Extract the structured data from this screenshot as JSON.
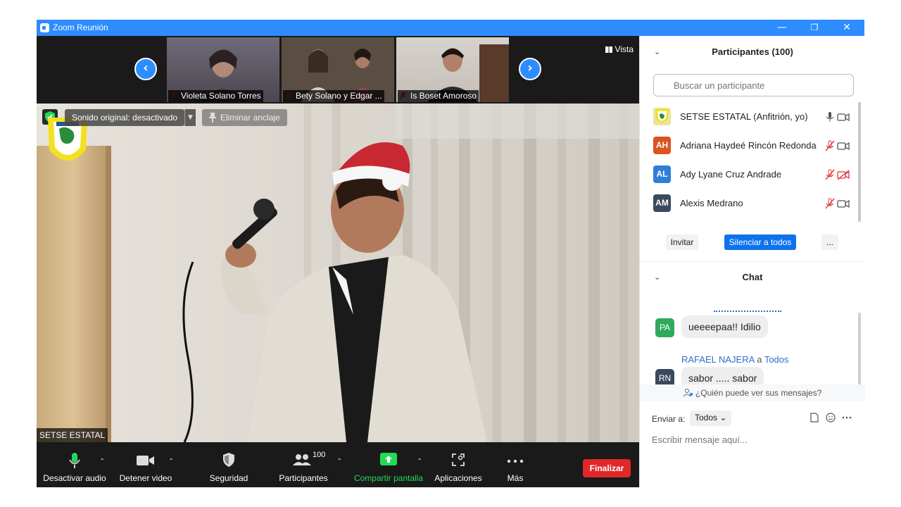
{
  "window": {
    "title": "Zoom Reunión",
    "minimize": "—",
    "restore": "❐",
    "close": "✕"
  },
  "strip": {
    "thumbs": [
      {
        "name": "Violeta Solano Torres"
      },
      {
        "name": "Bety Solano y Edgar ..."
      },
      {
        "name": "Is Boset Amoroso"
      }
    ],
    "prev": "‹",
    "next": "›",
    "view_label": "Vista"
  },
  "main": {
    "sound": "Sonido original: desactivado",
    "unpin": "Eliminar anclaje",
    "speaker": "SETSE ESTATAL"
  },
  "toolbar": {
    "audio": "Desactivar audio",
    "video": "Detener video",
    "security": "Seguridad",
    "participants": "Participantes",
    "participants_count": "100",
    "share": "Compartir pantalla",
    "apps": "Aplicaciones",
    "more": "Más",
    "end": "Finalizar"
  },
  "participants_panel": {
    "title": "Participantes (100)",
    "search_placeholder": "Buscar un participante",
    "list": [
      {
        "initials": "",
        "name": "SETSE ESTATAL (Anfitrión, yo)",
        "color": "#d8d04a",
        "mic_muted": false,
        "cam_off": false
      },
      {
        "initials": "AH",
        "name": "Adriana Haydeé Rincón Redonda",
        "color": "#d9541e",
        "mic_muted": true,
        "cam_off": false
      },
      {
        "initials": "AL",
        "name": "Ady Lyane Cruz Andrade",
        "color": "#2e7fd6",
        "mic_muted": true,
        "cam_off": true
      },
      {
        "initials": "AM",
        "name": "Alexis Medrano",
        "color": "#3a4a5e",
        "mic_muted": true,
        "cam_off": false
      }
    ],
    "invite": "Invitar",
    "mute_all": "Silenciar a todos",
    "more": "..."
  },
  "chat": {
    "title": "Chat",
    "messages": [
      {
        "initials": "PA",
        "color": "#2eaa5c",
        "sender": "",
        "text": "ueeeepaa!! Idilio"
      },
      {
        "initials": "RN",
        "color": "#3a4a5e",
        "sender": "RAFAEL NAJERA",
        "to_word": "a",
        "recipient": "Todos",
        "text": "sabor ..... sabor"
      }
    ],
    "who_sees": "¿Quién puede ver sus mensajes?",
    "send_to_label": "Enviar a:",
    "send_to_value": "Todos",
    "input_placeholder": "Escribir mensaje aquí..."
  }
}
